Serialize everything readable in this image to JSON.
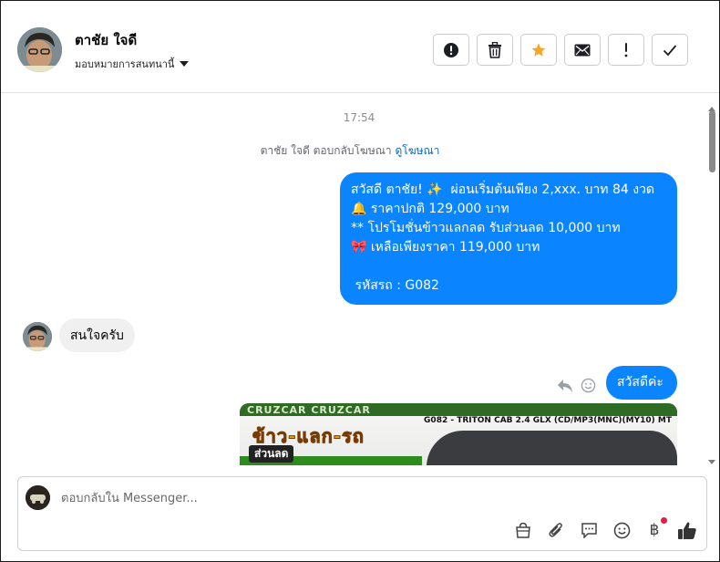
{
  "header": {
    "contact_name": "ตาชัย ใจดี",
    "assign_label": "มอบหมายการสนทนานี้",
    "actions": [
      {
        "name": "spam-button",
        "icon": "exclamation-circle-icon"
      },
      {
        "name": "delete-button",
        "icon": "trash-icon"
      },
      {
        "name": "star-button",
        "icon": "star-icon"
      },
      {
        "name": "mark-unread-button",
        "icon": "envelope-icon"
      },
      {
        "name": "follow-up-button",
        "icon": "exclamation-icon"
      },
      {
        "name": "mark-done-button",
        "icon": "check-icon"
      }
    ],
    "accent_star": "#f5a623"
  },
  "thread": {
    "timestamp": "17:54",
    "ad_reply_text": "ตาชัย ใจดี ตอบกลับโฆษณา",
    "ad_link": "ดูโฆษณา",
    "outgoing_1": {
      "lines": [
        "สวัสดี ตาชัย! ✨  ผ่อนเริ่มต้นเพียง 2,xxx. บาท 84 งวด",
        "🔔 ราคาปกติ 129,000 บาท",
        "** โปรโมชั่นข้าวแลกลด รับส่วนลด 10,000 บาท",
        "🎀 เหลือเพียงราคา 119,000 บาท",
        "",
        " รหัสรถ : G082"
      ]
    },
    "incoming_1": "สนใจครับ",
    "outgoing_2": "สวัสดีค่ะ",
    "image": {
      "band_text": "CRUZCAR CRUZCAR",
      "code_text": "G082 - TRITON CAB 2.4 GLX (CD/MP3(MNC)(MY10) MT",
      "headline": "ข้าว-แลก-รถ",
      "sub": "ส่วนลด"
    },
    "bubble_color": "#0b84ff"
  },
  "composer": {
    "placeholder": "ตอบกลับใน Messenger...",
    "value": "",
    "tools": [
      "shopping-bag-icon",
      "paperclip-icon",
      "speech-bubble-icon",
      "smiley-icon",
      "baht-icon",
      "thumbs-up-icon"
    ],
    "baht_symbol": "฿"
  }
}
